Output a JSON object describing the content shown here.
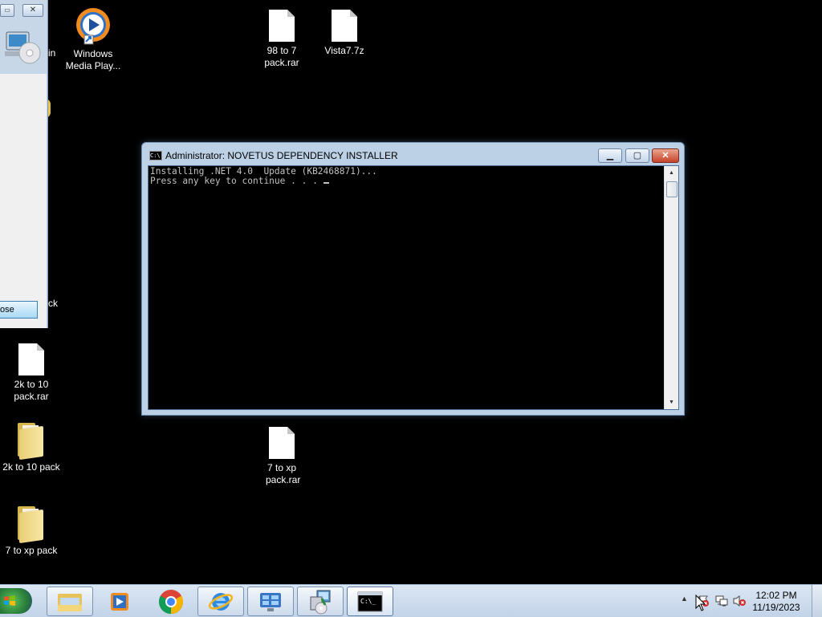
{
  "desktop": {
    "icons": [
      {
        "label": "Windows Media Play...",
        "type": "media-player"
      },
      {
        "label": "98 to 7 pack.rar",
        "type": "file"
      },
      {
        "label": "Vista7.7z",
        "type": "file"
      },
      {
        "label": "2k to 10 pack.rar",
        "type": "file"
      },
      {
        "label": "2k to 10 pack",
        "type": "folder"
      },
      {
        "label": "7 to xp pack.rar",
        "type": "file"
      },
      {
        "label": "7 to xp pack",
        "type": "folder"
      }
    ],
    "partial_labels": {
      "in": "in",
      "ck": "ck"
    }
  },
  "left_window": {
    "close_button": "ose"
  },
  "console": {
    "title": "Administrator:  NOVETUS DEPENDENCY INSTALLER",
    "lines": [
      "Installing .NET 4.0  Update (KB2468871)...",
      "Press any key to continue . . . "
    ],
    "controls": {
      "minimize": "minimize",
      "maximize": "maximize",
      "close": "close"
    }
  },
  "taskbar": {
    "items": [
      {
        "name": "windows-explorer",
        "active": false
      },
      {
        "name": "windows-media-player",
        "active": false
      },
      {
        "name": "google-chrome",
        "active": false
      },
      {
        "name": "internet-explorer",
        "active": false
      },
      {
        "name": "control-panel",
        "active": false
      },
      {
        "name": "installer",
        "active": false
      },
      {
        "name": "command-prompt",
        "active": true
      }
    ],
    "clock": {
      "time": "12:02 PM",
      "date": "11/19/2023"
    }
  },
  "colors": {
    "desktop_bg": "#000000",
    "taskbar": "#c9d8ea",
    "console_text": "#c0c0c0",
    "close_red": "#c8432b"
  }
}
